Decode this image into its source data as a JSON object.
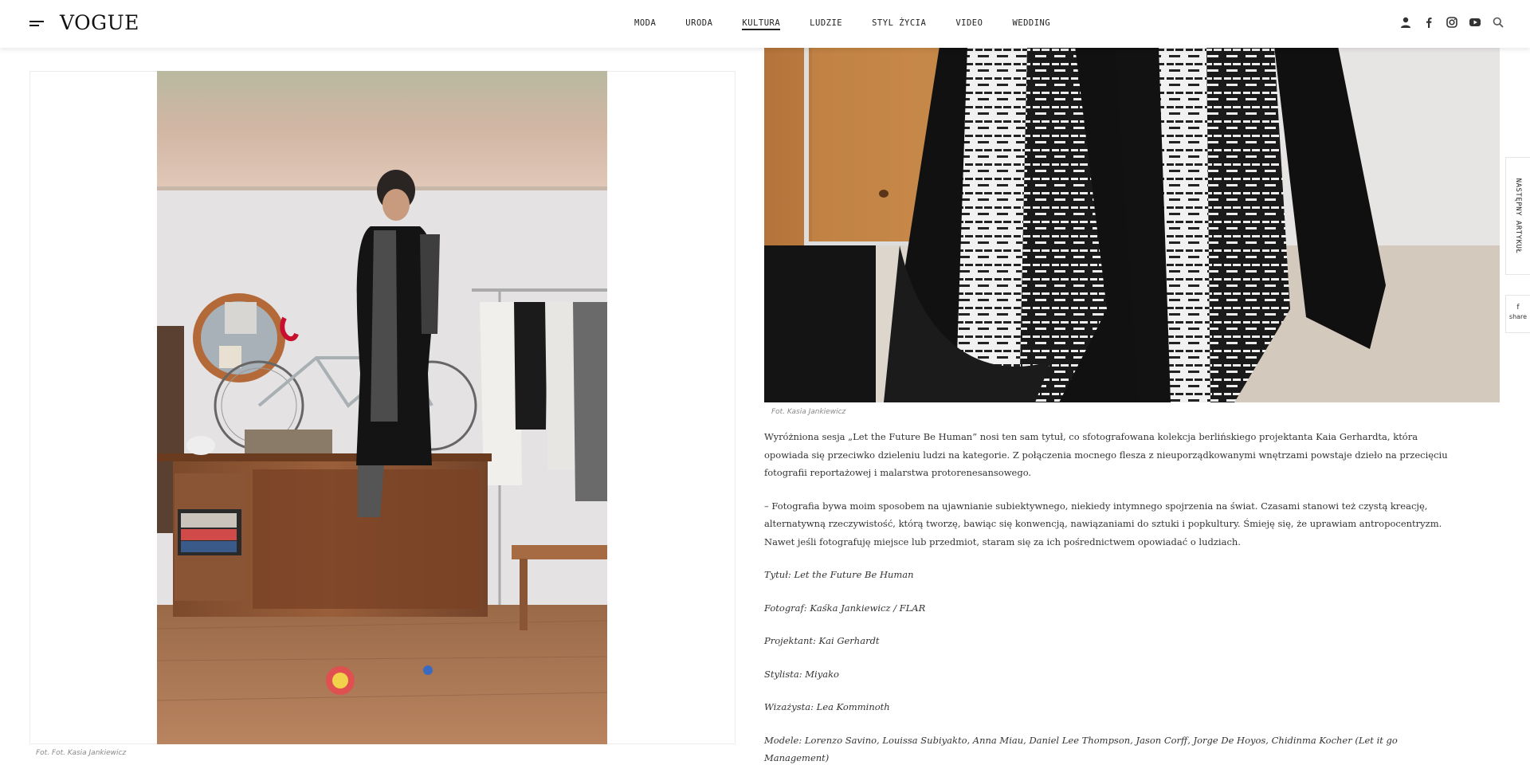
{
  "header": {
    "logo": "VOGUE",
    "nav": [
      "MODA",
      "URODA",
      "KULTURA",
      "LUDZIE",
      "STYL ŻYCIA",
      "VIDEO",
      "WEDDING"
    ],
    "active_nav": "KULTURA",
    "icons": [
      "user-icon",
      "facebook-icon",
      "instagram-icon",
      "youtube-icon",
      "search-icon"
    ]
  },
  "gallery": {
    "left_caption": "Fot. Fot. Kasia Jankiewicz",
    "right_caption": "Fot. Kasia Jankiewicz"
  },
  "article": {
    "paragraphs": [
      "Wyróżniona sesja „Let the Future Be Human” nosi ten sam tytuł, co sfotografowana kolekcja berlińskiego projektanta Kaia Gerhardta, która opowiada się przeciwko dzieleniu ludzi na kategorie. Z połączenia mocnego flesza z nieuporządkowanymi wnętrzami powstaje dzieło na przecięciu fotografii reportażowej i malarstwa protorenesansowego.",
      "– Fotografia bywa moim sposobem na ujawnianie subiektywnego, niekiedy intymnego spojrzenia na świat. Czasami stanowi też czystą kreację, alternatywną rzeczywistość, którą tworzę, bawiąc się konwencją, nawiązaniami do sztuki i popkultury. Śmieję się, że uprawiam antropocentryzm. Nawet jeśli fotografuję miejsce lub przedmiot, staram się za ich pośrednictwem opowiadać o ludziach."
    ],
    "credits": [
      "Tytuł: Let the Future Be Human",
      "Fotograf: Kaśka Jankiewicz / FLAR",
      "Projektant: Kai Gerhardt",
      "Stylista: Miyako",
      "Wizażysta: Lea Komminoth",
      "Modele: Lorenzo Savino, Louissa Subiyakto, Anna Miau, Daniel Lee Thompson, Jason Corff, Jorge De Hoyos, Chidinma Kocher (Let it go Management)"
    ]
  },
  "side": {
    "next_article": "NASTĘPNY ARTYKUŁ",
    "share_icon": "f",
    "share_label": "share"
  },
  "colors": {
    "text": "#333333",
    "caption": "#888888",
    "border": "#ececec"
  }
}
